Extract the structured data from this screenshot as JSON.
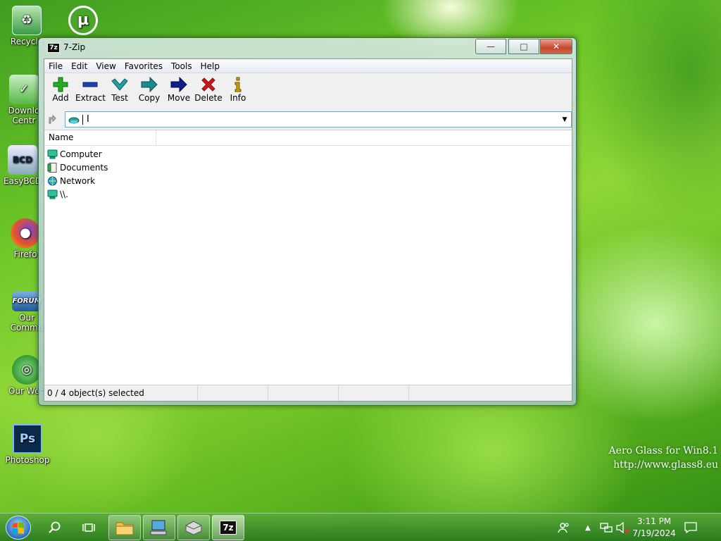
{
  "desktop": {
    "icons": [
      {
        "label": "Recycle",
        "icon": "recycle-bin-icon"
      },
      {
        "label": "",
        "icon": "utorrent-icon"
      },
      {
        "label": "Downlo",
        "label2": "Centr",
        "icon": "download-center-icon"
      },
      {
        "label": "EasyBCD",
        "icon": "easybcd-icon"
      },
      {
        "label": "Firefo",
        "icon": "firefox-icon"
      },
      {
        "label": "Our",
        "label2": "Commu",
        "icon": "forum-icon"
      },
      {
        "label": "Our Web",
        "icon": "website-icon"
      },
      {
        "label": "Photoshop",
        "icon": "photoshop-icon"
      }
    ],
    "watermark": {
      "line1": "Aero Glass for Win8.1",
      "line2": "http://www.glass8.eu"
    }
  },
  "window": {
    "app_icon_text": "7z",
    "title": "7-Zip",
    "minimize": "—",
    "maximize": "□",
    "close": "✕"
  },
  "menu": [
    "File",
    "Edit",
    "View",
    "Favorites",
    "Tools",
    "Help"
  ],
  "toolbar": [
    {
      "label": "Add",
      "icon": "plus-icon",
      "color": "#22b022"
    },
    {
      "label": "Extract",
      "icon": "minus-icon",
      "color": "#1c3fb0"
    },
    {
      "label": "Test",
      "icon": "check-icon",
      "color": "#1ea0a0"
    },
    {
      "label": "Copy",
      "icon": "arrow-right-icon",
      "color": "#1a8a8a"
    },
    {
      "label": "Move",
      "icon": "arrow-right-icon",
      "color": "#101e8a"
    },
    {
      "label": "Delete",
      "icon": "x-icon",
      "color": "#d01818"
    },
    {
      "label": "Info",
      "icon": "info-icon",
      "color": "#b09000"
    }
  ],
  "address": {
    "value": "",
    "placeholder": ""
  },
  "columns": {
    "name": "Name"
  },
  "files": [
    {
      "name": "Computer",
      "icon": "computer-icon"
    },
    {
      "name": "Documents",
      "icon": "documents-icon"
    },
    {
      "name": "Network",
      "icon": "network-icon"
    },
    {
      "name": "\\\\.",
      "icon": "drive-icon"
    }
  ],
  "status": {
    "selected": "0 / 4 object(s) selected"
  },
  "taskbar": {
    "time": "3:11 PM",
    "date": "7/19/2024",
    "pinned_7z_text": "7z"
  }
}
